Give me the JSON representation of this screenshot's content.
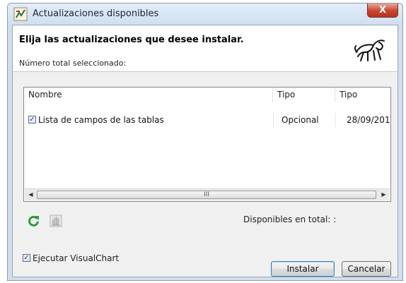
{
  "window": {
    "title": "Actualizaciones disponibles",
    "close_glyph": "X"
  },
  "header": {
    "title": "Elija las actualizaciones que desee instalar.",
    "selected_count_label": "Número total seleccionado:"
  },
  "list": {
    "columns": [
      "Nombre",
      "Tipo",
      "Tipo"
    ],
    "rows": [
      {
        "checked": true,
        "name": "Lista de campos de las tablas",
        "type": "Opcional",
        "date": "28/09/201."
      }
    ],
    "scroll_thumb_grip": "III"
  },
  "toolbar": {
    "refresh_icon": "refresh-icon",
    "select_all_icon": "hand-icon"
  },
  "available_label": "Disponibles en total: :",
  "run_option": {
    "checked": true,
    "label": "Ejecutar VisualChart"
  },
  "buttons": {
    "install": "Instalar",
    "cancel": "Cancelar"
  },
  "colors": {
    "accent": "#3c7fb1",
    "refresh_green": "#2e9b3a",
    "close_red": "#c7452f"
  }
}
